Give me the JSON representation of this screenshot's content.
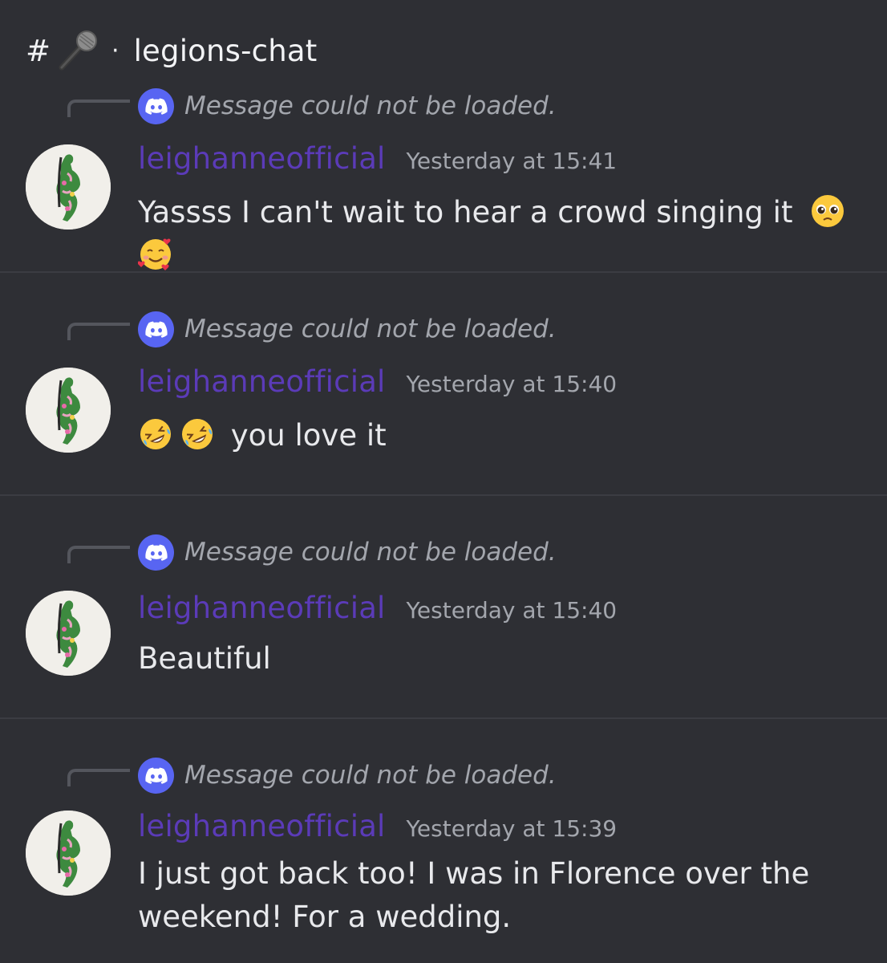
{
  "channel": {
    "hash": "#",
    "icon": "microphone-icon",
    "separator": "·",
    "name": "legions-chat"
  },
  "reply_placeholder": "Message could not be loaded.",
  "messages": [
    {
      "author": "leighanneofficial",
      "timestamp": "Yesterday at 15:41",
      "lines": [
        "Yassss I can't wait to hear a crowd singing it"
      ],
      "trailing_emojis": [
        "pleading-face",
        "smiling-face-with-hearts"
      ]
    },
    {
      "author": "leighanneofficial",
      "timestamp": "Yesterday at 15:40",
      "leading_emojis": [
        "rolling-on-floor-laughing",
        "rolling-on-floor-laughing"
      ],
      "lines": [
        "you love it"
      ]
    },
    {
      "author": "leighanneofficial",
      "timestamp": "Yesterday at 15:40",
      "lines": [
        "Beautiful"
      ]
    },
    {
      "author": "leighanneofficial",
      "timestamp": "Yesterday at 15:39",
      "lines": [
        "I just got back too! I was in Florence over the",
        "weekend! For a wedding."
      ]
    }
  ],
  "colors": {
    "background": "#2e2f34",
    "author": "#5b3bb8",
    "discord_blurple": "#5865f2",
    "muted_text": "#a3a6ad"
  }
}
